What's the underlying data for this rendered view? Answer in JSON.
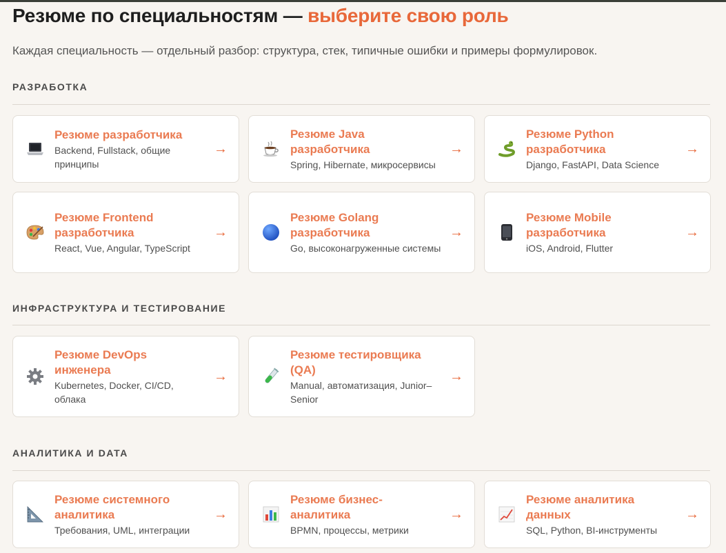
{
  "header": {
    "title_main": "Резюме по специальностям — ",
    "title_accent": "выберите свою роль",
    "subtitle": "Каждая специальность — отдельный разбор: структура, стек, типичные ошибки и примеры формулировок."
  },
  "colors": {
    "accent": "#e8683a",
    "card_title": "#ea7b52",
    "background": "#f8f5f1",
    "card_bg": "#ffffff"
  },
  "arrow": "→",
  "sections": [
    {
      "title": "РАЗРАБОТКА",
      "cards": [
        {
          "icon": "laptop-icon",
          "title": "Резюме разработчика",
          "desc": "Backend, Fullstack, общие принципы"
        },
        {
          "icon": "coffee-cup-icon",
          "title": "Резюме Java разработчика",
          "desc": "Spring, Hibernate, микросервисы"
        },
        {
          "icon": "snake-icon",
          "title": "Резюме Python разработчика",
          "desc": "Django, FastAPI, Data Science"
        },
        {
          "icon": "palette-icon",
          "title": "Резюме Frontend разработчика",
          "desc": "React, Vue, Angular, TypeScript"
        },
        {
          "icon": "blue-circle-icon",
          "title": "Резюме Golang разработчика",
          "desc": "Go, высоконагруженные системы"
        },
        {
          "icon": "mobile-phone-icon",
          "title": "Резюме Mobile разработчика",
          "desc": "iOS, Android, Flutter"
        }
      ]
    },
    {
      "title": "ИНФРАСТРУКТУРА И ТЕСТИРОВАНИЕ",
      "cards": [
        {
          "icon": "gear-icon",
          "title": "Резюме DevOps инженера",
          "desc": "Kubernetes, Docker, CI/CD, облака"
        },
        {
          "icon": "test-tube-icon",
          "title": "Резюме тестировщика (QA)",
          "desc": "Manual, автоматизация, Junior–Senior"
        }
      ]
    },
    {
      "title": "АНАЛИТИКА И DATA",
      "cards": [
        {
          "icon": "triangular-ruler-icon",
          "title": "Резюме системного аналитика",
          "desc": "Требования, UML, интеграции"
        },
        {
          "icon": "bar-chart-icon",
          "title": "Резюме бизнес-аналитика",
          "desc": "BPMN, процессы, метрики"
        },
        {
          "icon": "line-chart-icon",
          "title": "Резюме аналитика данных",
          "desc": "SQL, Python, BI-инструменты"
        }
      ]
    }
  ]
}
